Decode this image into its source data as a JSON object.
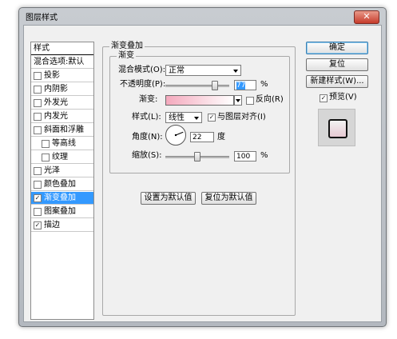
{
  "window": {
    "title": "图层样式",
    "close_glyph": "✕"
  },
  "sidebar": {
    "items": [
      {
        "label": "样式",
        "checkbox": false,
        "checked": false,
        "indent": 0,
        "header": true
      },
      {
        "label": "混合选项:默认",
        "checkbox": false,
        "checked": false,
        "indent": 0
      },
      {
        "label": "投影",
        "checkbox": true,
        "checked": false,
        "indent": 0
      },
      {
        "label": "内阴影",
        "checkbox": true,
        "checked": false,
        "indent": 0
      },
      {
        "label": "外发光",
        "checkbox": true,
        "checked": false,
        "indent": 0
      },
      {
        "label": "内发光",
        "checkbox": true,
        "checked": false,
        "indent": 0
      },
      {
        "label": "斜面和浮雕",
        "checkbox": true,
        "checked": false,
        "indent": 0
      },
      {
        "label": "等高线",
        "checkbox": true,
        "checked": false,
        "indent": 1
      },
      {
        "label": "纹理",
        "checkbox": true,
        "checked": false,
        "indent": 1
      },
      {
        "label": "光泽",
        "checkbox": true,
        "checked": false,
        "indent": 0
      },
      {
        "label": "颜色叠加",
        "checkbox": true,
        "checked": false,
        "indent": 0
      },
      {
        "label": "渐变叠加",
        "checkbox": true,
        "checked": true,
        "indent": 0,
        "selected": true
      },
      {
        "label": "图案叠加",
        "checkbox": true,
        "checked": false,
        "indent": 0
      },
      {
        "label": "描边",
        "checkbox": true,
        "checked": true,
        "indent": 0
      }
    ]
  },
  "panel": {
    "group_title": "渐变叠加",
    "subgroup_title": "渐变",
    "blend_mode_label": "混合模式(O):",
    "blend_mode_value": "正常",
    "opacity_label": "不透明度(P):",
    "opacity_value": "77",
    "opacity_unit": "%",
    "opacity_fraction": 0.77,
    "gradient_label": "渐变:",
    "gradient_colors": [
      "#f4a9bd",
      "#ffffff"
    ],
    "reverse_label": "反向(R)",
    "reverse_checked": false,
    "style_label": "样式(L):",
    "style_value": "线性",
    "align_label": "与图层对齐(I)",
    "align_checked": true,
    "angle_label": "角度(N):",
    "angle_value": "22",
    "angle_unit": "度",
    "angle_degrees": 22,
    "scale_label": "缩放(S):",
    "scale_value": "100",
    "scale_unit": "%",
    "scale_fraction": 0.5,
    "set_default_label": "设置为默认值",
    "reset_default_label": "复位为默认值"
  },
  "buttons": {
    "ok_label": "确定",
    "reset_label": "复位",
    "new_style_label": "新建样式(W)...",
    "preview_label": "预览(V)",
    "preview_checked": true
  },
  "icons": [
    "close-icon",
    "checkbox-checked-icon",
    "dropdown-arrow-icon",
    "angle-dial-icon",
    "slider-thumb-icon"
  ],
  "colors": {
    "selection": "#3399ff",
    "dialog_bg": "#f0f0f0",
    "frame": "#b9bec5",
    "close": "#c63b2b"
  }
}
